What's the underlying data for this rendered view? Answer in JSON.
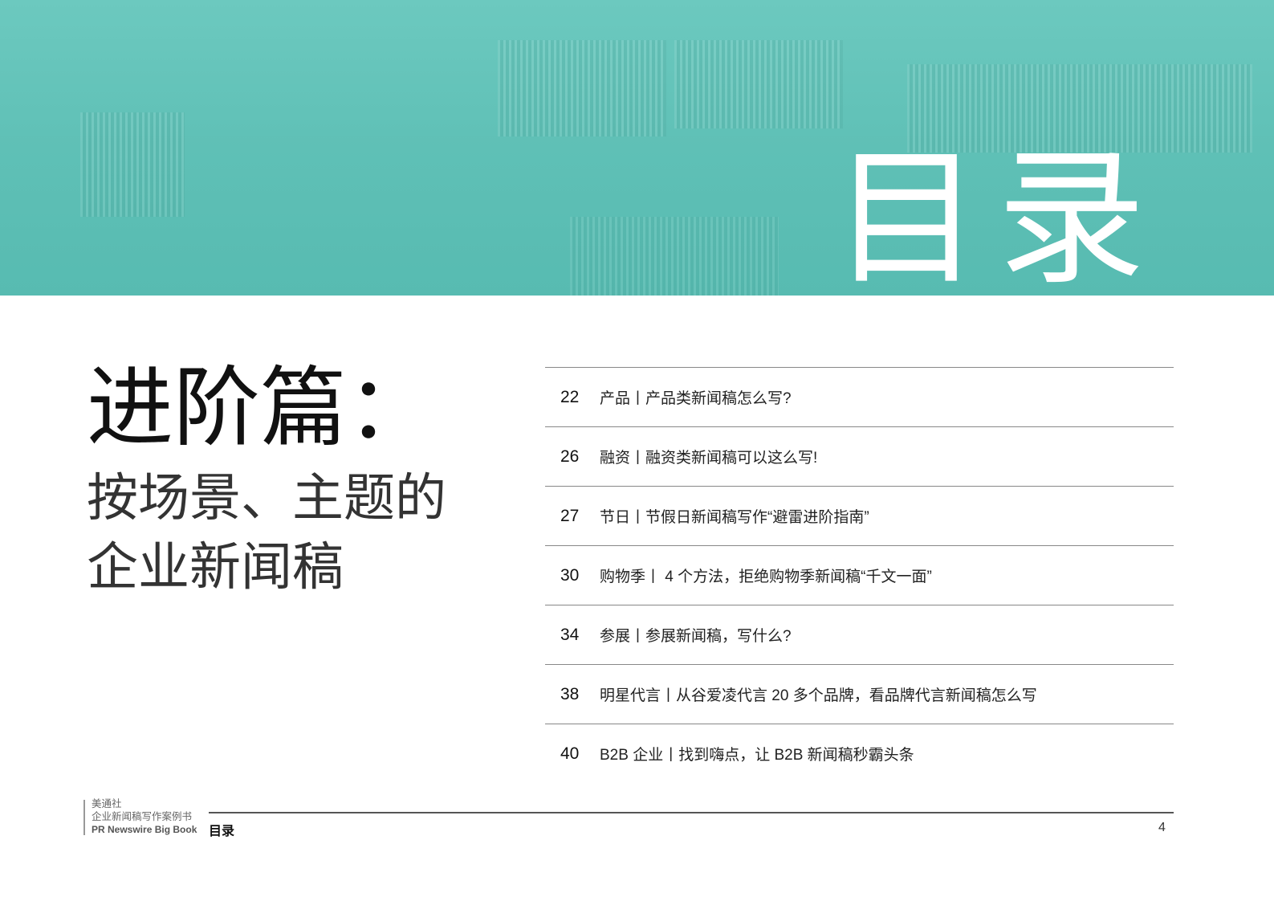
{
  "header": {
    "title": "目录"
  },
  "section": {
    "title": "进阶篇：",
    "subtitle_lines": [
      "按场景、主题的",
      "企业新闻稿"
    ]
  },
  "toc": [
    {
      "page": "22",
      "text": "产品丨产品类新闻稿怎么写?"
    },
    {
      "page": "26",
      "text": "融资丨融资类新闻稿可以这么写!"
    },
    {
      "page": "27",
      "text": "节日丨节假日新闻稿写作“避雷进阶指南”"
    },
    {
      "page": "30",
      "text": "购物季丨 4 个方法，拒绝购物季新闻稿“千文一面”"
    },
    {
      "page": "34",
      "text": "参展丨参展新闻稿，写什么?"
    },
    {
      "page": "38",
      "text": "明星代言丨从谷爱凌代言 20 多个品牌，看品牌代言新闻稿怎么写"
    },
    {
      "page": "40",
      "text": "B2B 企业丨找到嗨点，让 B2B 新闻稿秒霸头条"
    }
  ],
  "footer": {
    "brand_cn": "美通社",
    "book_cn": "企业新闻稿写作案例书",
    "book_en": "PR Newswire Big Book",
    "section": "目录",
    "page": "4"
  }
}
